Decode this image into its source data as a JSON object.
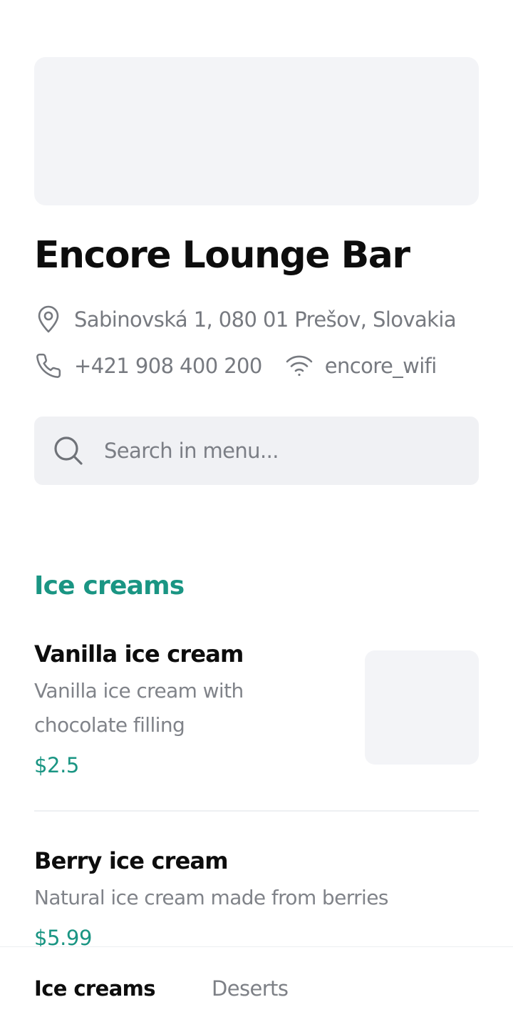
{
  "venue": {
    "name": "Encore Lounge Bar",
    "address": "Sabinovská 1, 080 01 Prešov, Slovakia",
    "phone": "+421 908 400 200",
    "wifi": "encore_wifi"
  },
  "search": {
    "placeholder": "Search in menu..."
  },
  "menu": {
    "sections": [
      {
        "title": "Ice creams",
        "items": [
          {
            "name": "Vanilla ice cream",
            "description": "Vanilla ice cream with chocolate filling",
            "price": "$2.5"
          },
          {
            "name": "Berry ice cream",
            "description": "Natural ice cream made from berries",
            "price": "$5.99"
          }
        ]
      }
    ]
  },
  "nav": {
    "tabs": [
      {
        "label": "Ice creams",
        "active": true
      },
      {
        "label": "Deserts",
        "active": false
      }
    ]
  },
  "colors": {
    "accent": "#1a9583",
    "placeholder_bg": "#f3f4f7",
    "search_bg": "#f0f1f4",
    "muted_text": "#777a80"
  },
  "icons": {
    "address": "map-pin-icon",
    "phone": "phone-icon",
    "wifi": "wifi-icon",
    "search": "search-icon"
  }
}
